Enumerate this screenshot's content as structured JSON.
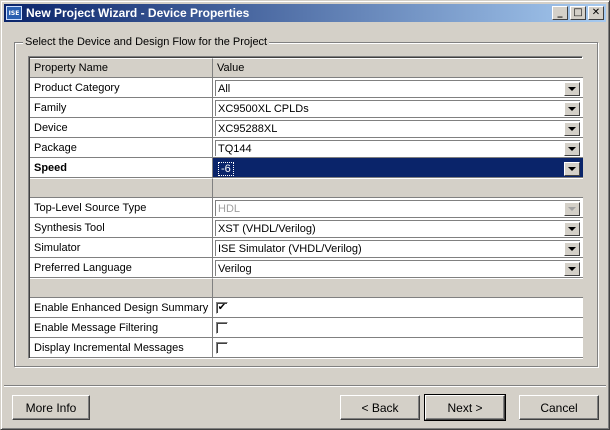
{
  "window": {
    "title": "New Project Wizard - Device Properties",
    "app_icon_text": "ISE",
    "controls": {
      "minimize": "_",
      "maximize": "□",
      "close": "✕"
    }
  },
  "group": {
    "legend": "Select the Device and Design Flow for the Project"
  },
  "table": {
    "headers": {
      "name": "Property Name",
      "value": "Value"
    },
    "rows": [
      {
        "name": "Product Category",
        "value": "All"
      },
      {
        "name": "Family",
        "value": "XC9500XL CPLDs"
      },
      {
        "name": "Device",
        "value": "XC95288XL"
      },
      {
        "name": "Package",
        "value": "TQ144"
      },
      {
        "name": "Speed",
        "value": "-6"
      },
      {
        "name": "Top-Level Source Type",
        "value": "HDL"
      },
      {
        "name": "Synthesis Tool",
        "value": "XST (VHDL/Verilog)"
      },
      {
        "name": "Simulator",
        "value": "ISE Simulator (VHDL/Verilog)"
      },
      {
        "name": "Preferred Language",
        "value": "Verilog"
      },
      {
        "name": "Enable Enhanced Design Summary",
        "checked": true
      },
      {
        "name": "Enable Message Filtering",
        "checked": false
      },
      {
        "name": "Display Incremental Messages",
        "checked": false
      }
    ],
    "check_mark": "✔"
  },
  "buttons": {
    "more_info": "More Info",
    "back": "< Back",
    "next": "Next >",
    "cancel": "Cancel"
  },
  "colors": {
    "title_bar_start": "#0a246a",
    "selection": "#0a246a",
    "face": "#d4d0c8"
  }
}
